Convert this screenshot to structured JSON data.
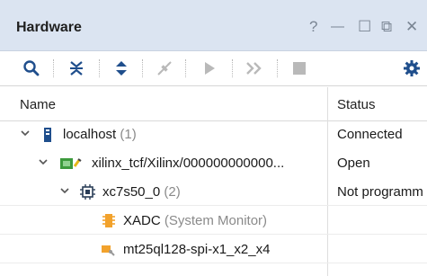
{
  "panel": {
    "title": "Hardware",
    "controls": {
      "help": "?",
      "minimize": "—",
      "maximize": "☐",
      "float": "⧉",
      "close": "✕"
    }
  },
  "toolbar": {
    "icons": [
      "search-icon",
      "collapse-all-icon",
      "expand-all-icon",
      "auto-connect-icon",
      "run-icon",
      "step-icon",
      "stop-icon",
      "gear-icon"
    ]
  },
  "columns": {
    "name": "Name",
    "status": "Status"
  },
  "tree": [
    {
      "label": "localhost",
      "count": "(1)",
      "status": "Connected"
    },
    {
      "label": "xilinx_tcf/Xilinx/000000000000...",
      "status": "Open"
    },
    {
      "label": "xc7s50_0",
      "count": "(2)",
      "status": "Not programm"
    },
    {
      "label": "XADC",
      "sublabel": "(System Monitor)",
      "status": ""
    },
    {
      "label": "mt25ql128-spi-x1_x2_x4",
      "status": ""
    }
  ],
  "colors": {
    "titlebar": "#dbe4f1",
    "accent": "#1f4e8c",
    "green": "#3c9a3c",
    "orange": "#f2a22c"
  }
}
